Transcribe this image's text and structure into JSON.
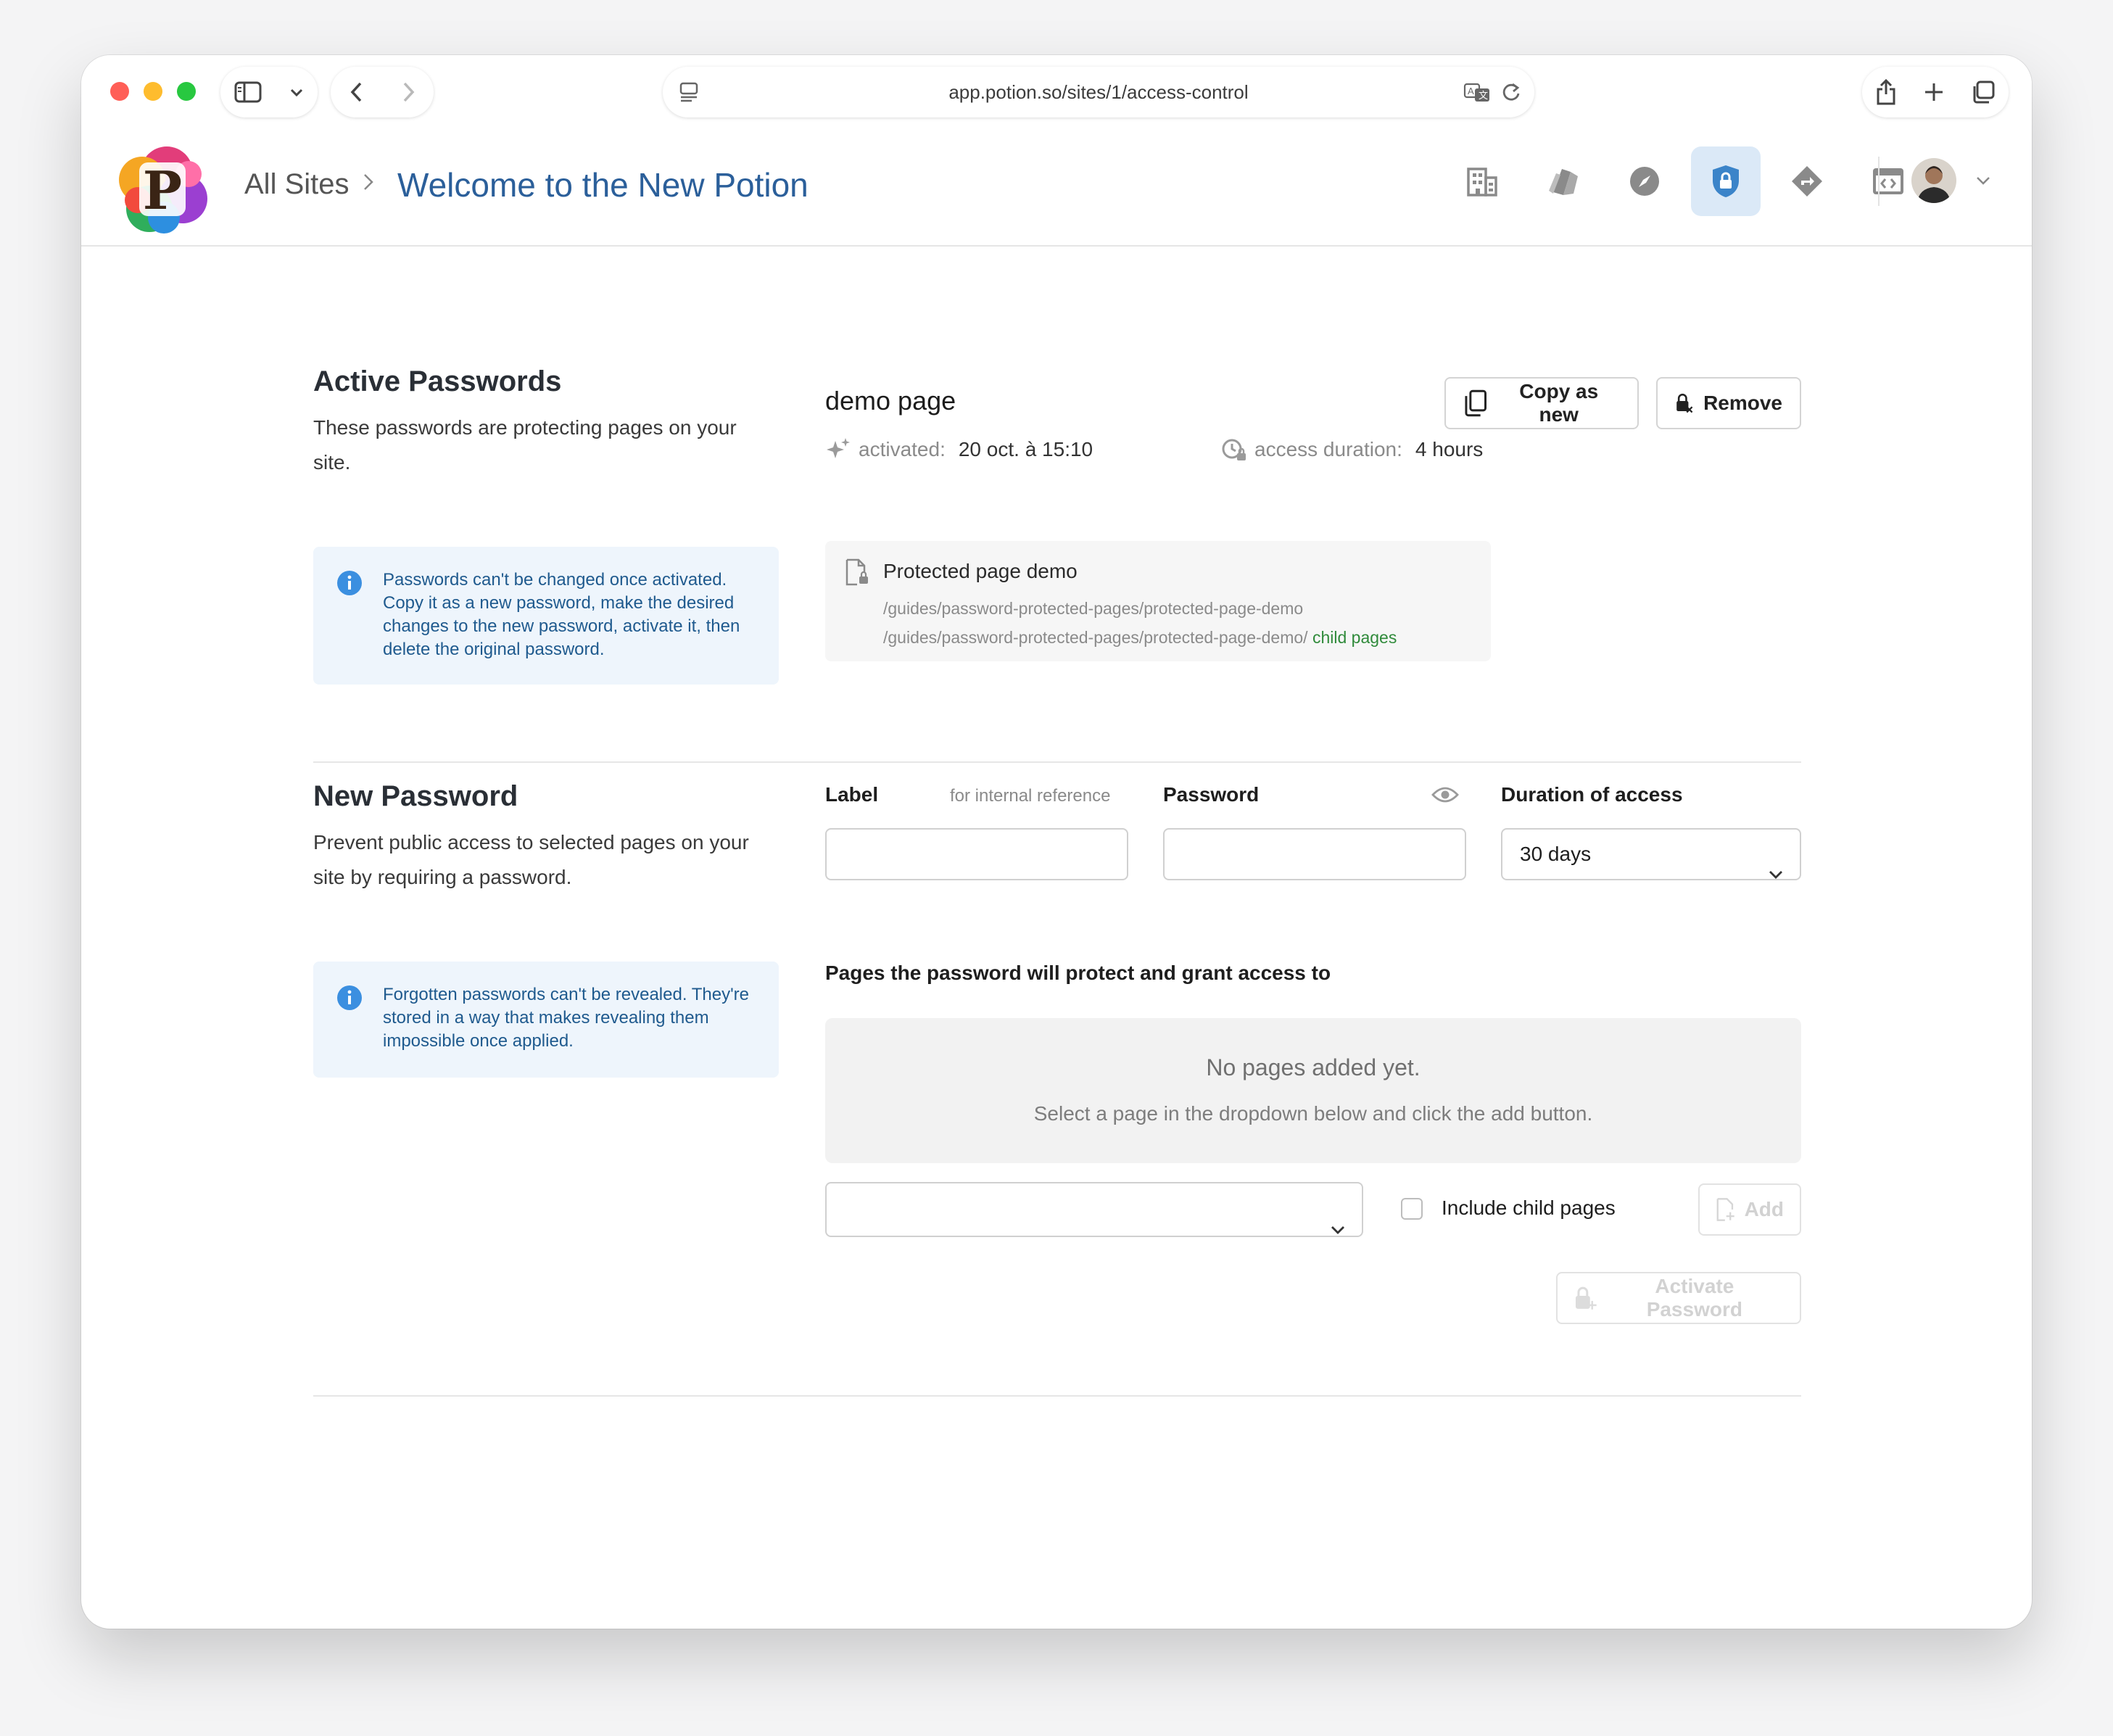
{
  "browser": {
    "url": "app.potion.so/sites/1/access-control"
  },
  "header": {
    "logo_letter": "P",
    "breadcrumb_root": "All Sites",
    "site_title": "Welcome to the New Potion",
    "nav_icons": [
      "building-icon",
      "pages-icon",
      "compass-icon",
      "shield-lock-icon",
      "redirect-icon",
      "code-window-icon"
    ],
    "active_nav": "shield-lock-icon"
  },
  "active_passwords": {
    "title": "Active Passwords",
    "description": "These passwords are protecting pages on your site.",
    "info": "Passwords can't be changed once activated. Copy it as a new password, make the desired changes to the new password, activate it, then delete the original password.",
    "item": {
      "name": "demo page",
      "copy_label": "Copy as new",
      "remove_label": "Remove",
      "activated_key": "activated:",
      "activated_value": "20 oct. à 15:10",
      "duration_key": "access duration:",
      "duration_value": "4 hours",
      "page_title": "Protected page demo",
      "path": "/guides/password-protected-pages/protected-page-demo",
      "child_path": "/guides/password-protected-pages/protected-page-demo/",
      "child_label": "child pages"
    }
  },
  "new_password": {
    "title": "New Password",
    "description": "Prevent public access to selected pages on your site by requiring a password.",
    "info": "Forgotten passwords can't be revealed. They're stored in a way that makes revealing them impossible once applied.",
    "label_field": "Label",
    "label_hint": "for internal reference",
    "label_value": "",
    "password_field": "Password",
    "password_value": "",
    "duration_field": "Duration of access",
    "duration_value": "30 days",
    "pages_label": "Pages the password will protect and grant access to",
    "empty_title": "No pages added yet.",
    "empty_sub": "Select a page in the dropdown below and click the add button.",
    "page_select_value": "",
    "include_child": "Include child pages",
    "add_label": "Add",
    "activate_label": "Activate Password"
  },
  "colors": {
    "accent": "#2b5f9a",
    "info_bg": "#eef5fc",
    "info_text": "#1f5a8e",
    "child_pages": "#2f8a3a",
    "active_nav_bg": "#dbe9f7"
  }
}
